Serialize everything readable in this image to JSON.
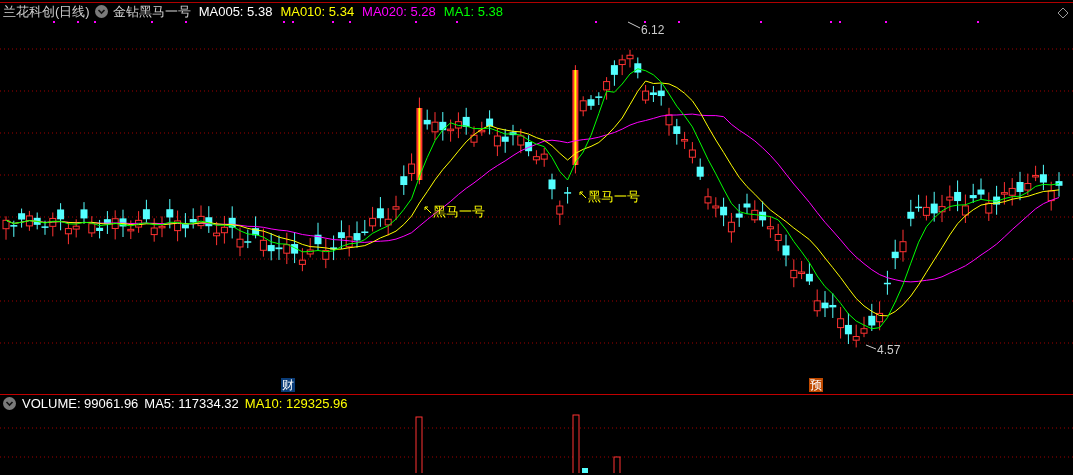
{
  "header": {
    "title": "兰花科创(日线)",
    "indicator": "金钻黑马一号",
    "legends": [
      {
        "label": "MA005: 5.38",
        "color": "#ffffff"
      },
      {
        "label": "MA010: 5.34",
        "color": "#ffff00"
      },
      {
        "label": "MA020: 5.28",
        "color": "#ff00ff"
      },
      {
        "label": "MA1: 5.38",
        "color": "#00ff00"
      }
    ]
  },
  "price_chart": {
    "high_label": "6.12",
    "low_label": "4.57",
    "signals": [
      {
        "label": "黑马一号"
      },
      {
        "label": "黑马一号"
      }
    ],
    "event_markers": [
      {
        "label": "财",
        "color": "#0a3c78"
      },
      {
        "label": "预",
        "color": "#c04a00"
      }
    ]
  },
  "volume_panel": {
    "legends": [
      {
        "label": "VOLUME: 99061.96",
        "color": "#ffffff"
      },
      {
        "label": "MA5: 117334.32",
        "color": "#ffffff"
      },
      {
        "label": "MA10: 129325.96",
        "color": "#ffff00"
      }
    ]
  }
}
